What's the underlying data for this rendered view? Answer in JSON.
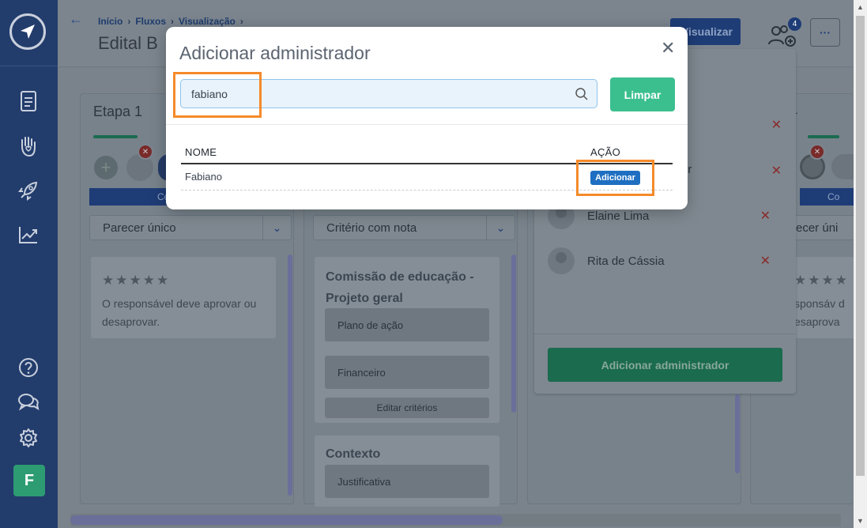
{
  "sidebar": {
    "avatar_letter": "F",
    "icons": [
      "document-icon",
      "hand-heart-icon",
      "rocket-icon",
      "chart-trend-icon",
      "help-icon",
      "chat-icon",
      "gear-icon"
    ]
  },
  "header": {
    "breadcrumb": [
      "Início",
      "Fluxos",
      "Visualização"
    ],
    "title": "Edital B",
    "visualize_label": "Visualizar",
    "notification_count": "4",
    "more_label": "···"
  },
  "columns": {
    "etapa1": {
      "title": "Etapa 1",
      "button_label": "Co",
      "select_value": "Parecer único",
      "card_text": "O responsável deve aprovar ou desaprovar."
    },
    "etapa2": {
      "select_value": "Critério com nota",
      "card1_title": "Comissão de educação - Projeto geral",
      "criteria": [
        "Plano de ação",
        "Financeiro"
      ],
      "edit_label": "Editar critérios",
      "card2_title": "Contexto",
      "card2_item": "Justificativa"
    },
    "etapa4": {
      "title": "a 4",
      "button_label": "Co",
      "select_value": "ecer úni",
      "card_text": "sponsáv desaprova"
    }
  },
  "admin_panel": {
    "partial_name": "or",
    "admins": [
      "Elaine Lima",
      "Rita de Cássia"
    ],
    "add_label": "Adicionar administrador"
  },
  "modal": {
    "title": "Adicionar administrador",
    "close_label": "✕",
    "search_value": "fabiano",
    "clear_label": "Limpar",
    "columns": [
      "NOME",
      "AÇÃO"
    ],
    "rows": [
      {
        "name": "Fabiano",
        "action": "Adicionar"
      }
    ]
  },
  "colors": {
    "primary": "#1e3c76",
    "accent_green": "#3bbf8f",
    "highlight": "#f58a2a",
    "add_button": "#1e6fc1"
  }
}
